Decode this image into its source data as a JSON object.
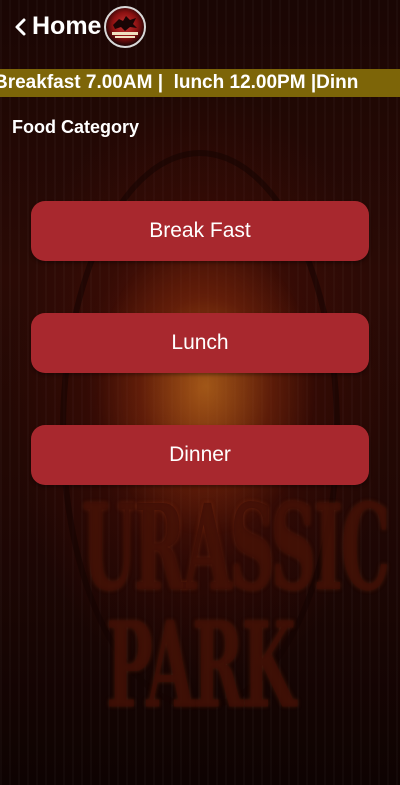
{
  "header": {
    "title": "Home",
    "back_icon": "chevron-left-icon",
    "logo_icon": "jurassic-park-logo"
  },
  "banner": {
    "text": "Breakfast 7.00AM |  lunch 12.00PM |Dinn"
  },
  "section": {
    "title": "Food Category"
  },
  "categories": [
    {
      "label": "Break Fast"
    },
    {
      "label": "Lunch"
    },
    {
      "label": "Dinner"
    }
  ],
  "background": {
    "logo_text": "JURASSIC PARK"
  },
  "colors": {
    "button": "#a8282e",
    "banner": "#7d6508",
    "text": "#ffffff"
  }
}
